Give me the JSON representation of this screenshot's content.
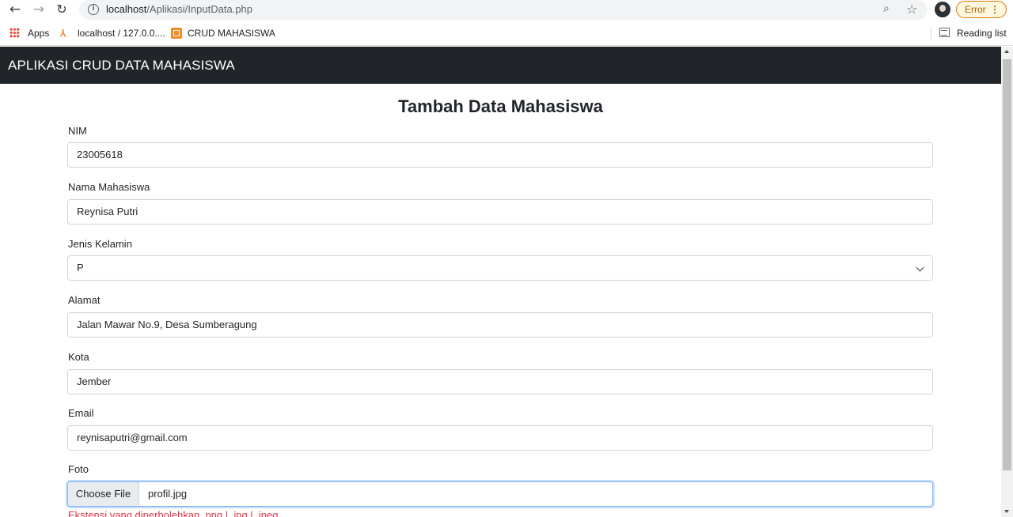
{
  "browser": {
    "url_host": "localhost",
    "url_path": "/Aplikasi/InputData.php",
    "error_label": "Error",
    "bookmarks": {
      "apps": "Apps",
      "localhost": "localhost / 127.0.0....",
      "crud": "CRUD MAHASISWA",
      "reading_list": "Reading list"
    }
  },
  "navbar": {
    "brand": "APLIKASI CRUD DATA MAHASISWA"
  },
  "form": {
    "title": "Tambah Data Mahasiswa",
    "nim": {
      "label": "NIM",
      "value": "23005618"
    },
    "nama": {
      "label": "Nama Mahasiswa",
      "value": "Reynisa Putri"
    },
    "jenis_kelamin": {
      "label": "Jenis Kelamin",
      "value": "P"
    },
    "alamat": {
      "label": "Alamat",
      "value": "Jalan Mawar No.9, Desa Sumberagung"
    },
    "kota": {
      "label": "Kota",
      "value": "Jember"
    },
    "email": {
      "label": "Email",
      "value": "reynisaputri@gmail.com"
    },
    "foto": {
      "label": "Foto",
      "button": "Choose File",
      "file_name": "profil.jpg",
      "helper": "Ekstensi yang diperbolehkan .png | .jpg | .jpeg"
    }
  },
  "colors": {
    "navbar": "#212529",
    "helper_text": "#dc3545",
    "focus_border": "#86b7fe"
  }
}
